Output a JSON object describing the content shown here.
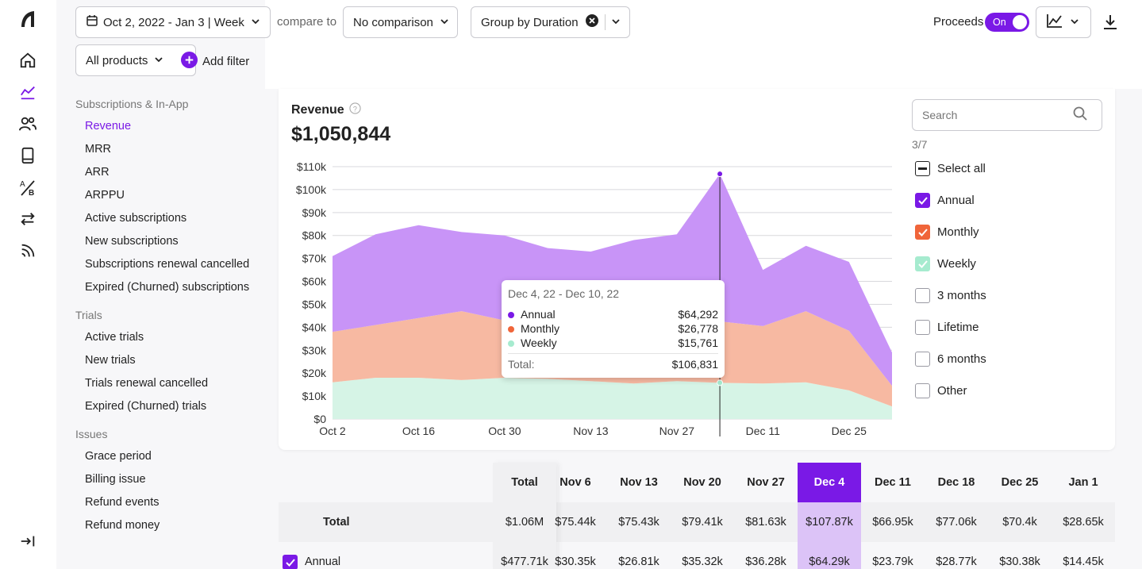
{
  "toolbar": {
    "date_range": "Oct 2, 2022 - Jan 3 | Week",
    "compare_label": "compare to",
    "comparison": "No comparison",
    "group_by": "Group by Duration",
    "proceeds_label": "Proceeds",
    "proceeds_toggle": "On",
    "products": "All products",
    "add_filter": "Add filter"
  },
  "sidebar": {
    "sections": [
      {
        "title": "Subscriptions & In-App",
        "items": [
          "Revenue",
          "MRR",
          "ARR",
          "ARPPU",
          "Active subscriptions",
          "New subscriptions",
          "Subscriptions renewal cancelled",
          "Expired (Churned) subscriptions"
        ]
      },
      {
        "title": "Trials",
        "items": [
          "Active trials",
          "New trials",
          "Trials renewal cancelled",
          "Expired (Churned) trials"
        ]
      },
      {
        "title": "Issues",
        "items": [
          "Grace period",
          "Billing issue",
          "Refund events",
          "Refund money"
        ]
      }
    ],
    "active": "Revenue"
  },
  "chart_header": {
    "title": "Revenue",
    "total": "$1,050,844"
  },
  "chart_data": {
    "type": "area",
    "stacked": true,
    "x": [
      "Oct 2",
      "Oct 9",
      "Oct 16",
      "Oct 23",
      "Oct 30",
      "Nov 6",
      "Nov 13",
      "Nov 20",
      "Nov 27",
      "Dec 4",
      "Dec 11",
      "Dec 18",
      "Dec 25",
      "Jan 1"
    ],
    "x_tick_labels": [
      "Oct 2",
      "Oct 16",
      "Oct 30",
      "Nov 13",
      "Nov 27",
      "Dec 11",
      "Dec 25"
    ],
    "y_tick_labels": [
      "$0",
      "$10k",
      "$20k",
      "$30k",
      "$40k",
      "$50k",
      "$60k",
      "$70k",
      "$80k",
      "$90k",
      "$100k",
      "$110k"
    ],
    "ylim": [
      0,
      110000
    ],
    "series": [
      {
        "name": "Weekly",
        "color": "#d6f4e6",
        "values": [
          16000,
          18000,
          18000,
          17000,
          18000,
          17500,
          16500,
          15500,
          16500,
          15761,
          15500,
          16000,
          12500,
          5500
        ]
      },
      {
        "name": "Monthly",
        "color": "#f7b9a2",
        "values": [
          22000,
          23000,
          26000,
          30000,
          25000,
          27000,
          28500,
          27500,
          28000,
          26778,
          25000,
          31000,
          26000,
          9000
        ]
      },
      {
        "name": "Annual",
        "color": "#c894f7",
        "values": [
          33000,
          39500,
          40500,
          34500,
          37000,
          30000,
          28000,
          35000,
          36000,
          64292,
          24500,
          28500,
          30000,
          14500
        ]
      }
    ],
    "grid": true
  },
  "tooltip": {
    "range": "Dec 4, 22 - Dec 10, 22",
    "rows": [
      {
        "name": "Annual",
        "value": "$64,292",
        "color": "#7a19e6"
      },
      {
        "name": "Monthly",
        "value": "$26,778",
        "color": "#f0653a"
      },
      {
        "name": "Weekly",
        "value": "$15,761",
        "color": "#a6ebcf"
      }
    ],
    "total_label": "Total:",
    "total_value": "$106,831"
  },
  "legend": {
    "search_placeholder": "Search",
    "count": "3/7",
    "select_all": "Select all",
    "items": [
      {
        "name": "Annual",
        "checked": true,
        "color": "#7a19e6"
      },
      {
        "name": "Monthly",
        "checked": true,
        "color": "#f0653a"
      },
      {
        "name": "Weekly",
        "checked": true,
        "color": "#a6ebcf"
      },
      {
        "name": "3 months",
        "checked": false,
        "color": ""
      },
      {
        "name": "Lifetime",
        "checked": false,
        "color": ""
      },
      {
        "name": "6 months",
        "checked": false,
        "color": ""
      },
      {
        "name": "Other",
        "checked": false,
        "color": ""
      }
    ]
  },
  "table": {
    "headers": [
      "Total",
      "Nov 6",
      "Nov 13",
      "Nov 20",
      "Nov 27",
      "Dec 4",
      "Dec 11",
      "Dec 18",
      "Dec 25",
      "Jan 1"
    ],
    "rows": [
      {
        "label": "Total",
        "values": [
          "$1.06M",
          "$75.44k",
          "$75.43k",
          "$79.41k",
          "$81.63k",
          "$107.87k",
          "$66.95k",
          "$77.06k",
          "$70.4k",
          "$28.65k"
        ]
      },
      {
        "label": "Annual",
        "values": [
          "$477.71k",
          "$30.35k",
          "$26.81k",
          "$35.32k",
          "$36.28k",
          "$64.29k",
          "$23.79k",
          "$28.77k",
          "$30.38k",
          "$14.45k"
        ]
      }
    ]
  },
  "colors": {
    "accent": "#7a19e6"
  }
}
